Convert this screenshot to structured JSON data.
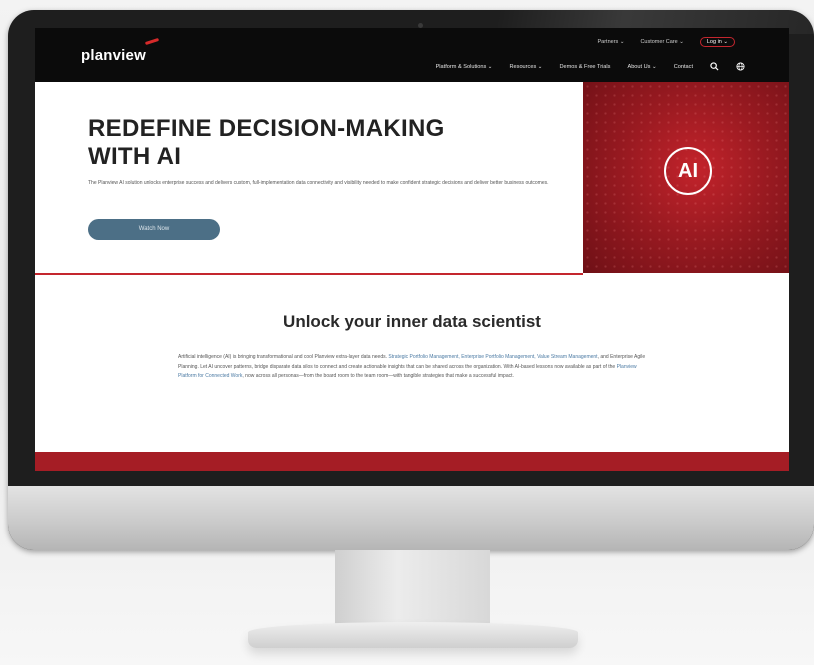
{
  "site": {
    "logo": "planview",
    "top_links": [
      "Partners ⌄",
      "Customer Care ⌄"
    ],
    "login": "Log in ⌄",
    "nav": [
      "Platform & Solutions ⌄",
      "Resources ⌄",
      "Demos & Free Trials",
      "About Us ⌄",
      "Contact"
    ],
    "icons": [
      "search-icon",
      "globe-icon"
    ]
  },
  "hero": {
    "title": "REDEFINE DECISION-MAKING WITH AI",
    "body": "The Planview AI solution unlocks enterprise success and delivers custom, full-implementation data connectivity and visibility needed to make confident strategic decisions and deliver better business outcomes.",
    "cta": "Watch Now",
    "badge": "AI"
  },
  "section": {
    "title": "Unlock your inner data scientist",
    "body_parts": [
      "Artificial intelligence (AI) is bringing transformational and cool Planview extra-layer data needs.",
      "Strategic Portfolio Management, Enterprise Portfolio Management, Value Stream Management",
      ", and Enterprise Agile Planning. Let AI uncover patterns, bridge disparate data silos to connect and create actionable insights that can be shared across the organization. With AI-based lessons now available as part of the",
      "Planview Platform for Connected Work",
      ", now across all personas—from the board room to the team room—with tangible strategies that make a successful impact."
    ]
  },
  "colors": {
    "accent_red": "#c4262e",
    "button_blue": "#4c6f86",
    "nav_black": "#0b0b0b"
  }
}
